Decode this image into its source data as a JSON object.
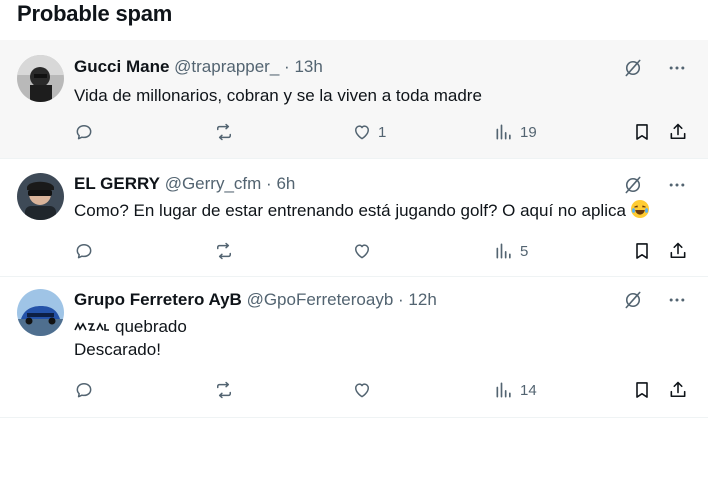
{
  "section": {
    "title": "Probable spam"
  },
  "colors": {
    "text": "#0f1419",
    "muted": "#536471",
    "highlight_bg": "#f7f7f7"
  },
  "icons": {
    "reply": "reply-icon",
    "repost": "repost-icon",
    "like": "heart-icon",
    "views": "views-icon",
    "bookmark": "bookmark-icon",
    "share": "share-icon",
    "grok": "grok-icon",
    "more": "more-icon"
  },
  "posts": [
    {
      "name": "Gucci Mane",
      "handle": "@traprapper_",
      "separator": "·",
      "time": "13h",
      "text_lines": [
        "Vida de millonarios, cobran y se la viven a toda madre"
      ],
      "likes": "1",
      "views": "19",
      "highlighted": true
    },
    {
      "name": "EL GERRY",
      "handle": "@Gerry_cfm",
      "separator": "·",
      "time": "6h",
      "text_lines": [
        "Como? En lugar de estar entrenando está jugando golf? O aquí no aplica"
      ],
      "emoji": "😂",
      "likes": "",
      "views": "5",
      "highlighted": false
    },
    {
      "name": "Grupo Ferretero AyB",
      "handle": "@GpoFerreteroayb",
      "separator": "·",
      "time": "12h",
      "text_lines": [
        "quebrado",
        "Descarado!"
      ],
      "likes": "",
      "views": "14",
      "highlighted": false
    }
  ]
}
